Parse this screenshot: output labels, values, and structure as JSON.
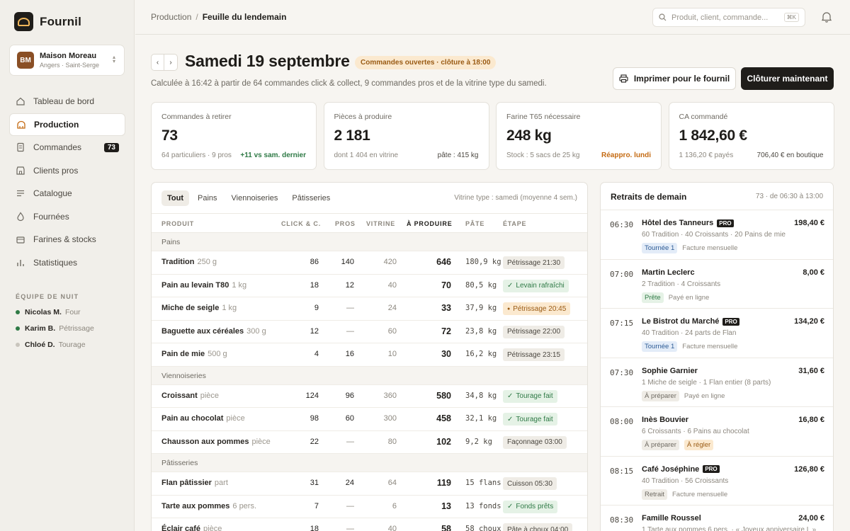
{
  "app": {
    "name": "Fournil"
  },
  "shop": {
    "initials": "BM",
    "name": "Maison Moreau",
    "location": "Angers · Saint-Serge"
  },
  "nav": [
    {
      "label": "Tableau de bord",
      "icon": "home-icon"
    },
    {
      "label": "Production",
      "icon": "bakery-icon",
      "active": true
    },
    {
      "label": "Commandes",
      "icon": "document-icon",
      "badge": "73"
    },
    {
      "label": "Clients pros",
      "icon": "storefront-icon"
    },
    {
      "label": "Catalogue",
      "icon": "list-icon"
    },
    {
      "label": "Fournées",
      "icon": "flame-icon"
    },
    {
      "label": "Farines & stocks",
      "icon": "stock-icon"
    },
    {
      "label": "Statistiques",
      "icon": "stats-icon"
    }
  ],
  "team": {
    "title": "ÉQUIPE DE NUIT",
    "members": [
      {
        "name": "Nicolas M.",
        "role": "Four",
        "color": "#2f7a46"
      },
      {
        "name": "Karim B.",
        "role": "Pétrissage",
        "color": "#2f7a46"
      },
      {
        "name": "Chloé D.",
        "role": "Tourage",
        "color": "#c9c5bd"
      }
    ]
  },
  "breadcrumb": {
    "parent": "Production",
    "current": "Feuille du lendemain"
  },
  "search": {
    "placeholder": "Produit, client, commande...",
    "shortcut": "⌘K"
  },
  "page": {
    "title": "Samedi 19 septembre",
    "status": "Commandes ouvertes · clôture à 18:00",
    "subtitle": "Calculée à 16:42 à partir de 64 commandes click & collect, 9 commandes pros et de la vitrine type du samedi.",
    "print_label": "Imprimer pour le fournil",
    "close_label": "Clôturer maintenant"
  },
  "kpis": [
    {
      "label": "Commandes à retirer",
      "value": "73",
      "foot_left": "64 particuliers · 9 pros",
      "foot_right": "+11 vs sam. dernier",
      "foot_style": "g"
    },
    {
      "label": "Pièces à produire",
      "value": "2 181",
      "foot_left": "dont 1 404 en vitrine",
      "foot_right": "pâte : 415 kg",
      "foot_style": "d"
    },
    {
      "label": "Farine T65 nécessaire",
      "value": "248 kg",
      "foot_left": "Stock : 5 sacs de 25 kg",
      "foot_right": "Réappro. lundi",
      "foot_style": "o"
    },
    {
      "label": "CA commandé",
      "value": "1 842,60 €",
      "foot_left": "1 136,20 € payés",
      "foot_right": "706,40 € en boutique",
      "foot_style": "d"
    }
  ],
  "table": {
    "tabs": [
      "Tout",
      "Pains",
      "Viennoiseries",
      "Pâtisseries"
    ],
    "note": "Vitrine type : samedi (moyenne 4 sem.)",
    "columns": [
      "PRODUIT",
      "CLICK & C.",
      "PROS",
      "VITRINE",
      "À PRODUIRE",
      "PÂTE",
      "ÉTAPE"
    ],
    "groups": [
      {
        "label": "Pains",
        "rows": [
          {
            "name": "Tradition",
            "unit": "250 g",
            "click": "86",
            "pros": "140",
            "vitrine": "420",
            "total": "646",
            "pate": "180,9 kg",
            "stage": "Pétrissage 21:30",
            "stage_style": "grey"
          },
          {
            "name": "Pain au levain T80",
            "unit": "1 kg",
            "click": "18",
            "pros": "12",
            "vitrine": "40",
            "total": "70",
            "pate": "80,5 kg",
            "stage": "Levain rafraîchi",
            "stage_style": "green"
          },
          {
            "name": "Miche de seigle",
            "unit": "1 kg",
            "click": "9",
            "pros": "—",
            "vitrine": "24",
            "total": "33",
            "pate": "37,9 kg",
            "stage": "Pétrissage 20:45",
            "stage_style": "orange"
          },
          {
            "name": "Baguette aux céréales",
            "unit": "300 g",
            "click": "12",
            "pros": "—",
            "vitrine": "60",
            "total": "72",
            "pate": "23,8 kg",
            "stage": "Pétrissage 22:00",
            "stage_style": "grey"
          },
          {
            "name": "Pain de mie",
            "unit": "500 g",
            "click": "4",
            "pros": "16",
            "vitrine": "10",
            "total": "30",
            "pate": "16,2 kg",
            "stage": "Pétrissage 23:15",
            "stage_style": "grey"
          }
        ]
      },
      {
        "label": "Viennoiseries",
        "rows": [
          {
            "name": "Croissant",
            "unit": "pièce",
            "click": "124",
            "pros": "96",
            "vitrine": "360",
            "total": "580",
            "pate": "34,8 kg",
            "stage": "Tourage fait",
            "stage_style": "green"
          },
          {
            "name": "Pain au chocolat",
            "unit": "pièce",
            "click": "98",
            "pros": "60",
            "vitrine": "300",
            "total": "458",
            "pate": "32,1 kg",
            "stage": "Tourage fait",
            "stage_style": "green"
          },
          {
            "name": "Chausson aux pommes",
            "unit": "pièce",
            "click": "22",
            "pros": "—",
            "vitrine": "80",
            "total": "102",
            "pate": "9,2 kg",
            "stage": "Façonnage 03:00",
            "stage_style": "grey"
          }
        ]
      },
      {
        "label": "Pâtisseries",
        "rows": [
          {
            "name": "Flan pâtissier",
            "unit": "part",
            "click": "31",
            "pros": "24",
            "vitrine": "64",
            "total": "119",
            "pate": "15 flans",
            "stage": "Cuisson 05:30",
            "stage_style": "grey"
          },
          {
            "name": "Tarte aux pommes",
            "unit": "6 pers.",
            "click": "7",
            "pros": "—",
            "vitrine": "6",
            "total": "13",
            "pate": "13 fonds",
            "stage": "Fonds prêts",
            "stage_style": "green"
          },
          {
            "name": "Éclair café",
            "unit": "pièce",
            "click": "18",
            "pros": "—",
            "vitrine": "40",
            "total": "58",
            "pate": "58 choux",
            "stage": "Pâte à choux 04:00",
            "stage_style": "grey"
          }
        ]
      }
    ]
  },
  "pickups": {
    "title": "Retraits de demain",
    "meta": "73 · de 06:30 à 13:00",
    "items": [
      {
        "time": "06:30",
        "name": "Hôtel des Tanneurs",
        "pro": "PRO",
        "amount": "198,40 €",
        "items": "60 Tradition · 40 Croissants · 20 Pains de mie",
        "tag": "Tournée 1",
        "tag_style": "blue",
        "note": "Facture mensuelle"
      },
      {
        "time": "07:00",
        "name": "Martin Leclerc",
        "pro": "",
        "amount": "8,00 €",
        "items": "2 Tradition · 4 Croissants",
        "tag": "Prête",
        "tag_style": "green",
        "note": "Payé en ligne"
      },
      {
        "time": "07:15",
        "name": "Le Bistrot du Marché",
        "pro": "PRO",
        "amount": "134,20 €",
        "items": "40 Tradition · 24 parts de Flan",
        "tag": "Tournée 1",
        "tag_style": "blue",
        "note": "Facture mensuelle"
      },
      {
        "time": "07:30",
        "name": "Sophie Garnier",
        "pro": "",
        "amount": "31,60 €",
        "items": "1 Miche de seigle · 1 Flan entier (8 parts)",
        "tag": "À préparer",
        "tag_style": "grey",
        "note": "Payé en ligne"
      },
      {
        "time": "08:00",
        "name": "Inès Bouvier",
        "pro": "",
        "amount": "16,80 €",
        "items": "6 Croissants · 6 Pains au chocolat",
        "tag": "À préparer",
        "tag_style": "grey",
        "tag2": "À régler",
        "tag2_style": "orange",
        "note": ""
      },
      {
        "time": "08:15",
        "name": "Café Joséphine",
        "pro": "PRO",
        "amount": "126,80 €",
        "items": "40 Tradition · 56 Croissants",
        "tag": "Retrait",
        "tag_style": "grey",
        "note": "Facture mensuelle"
      },
      {
        "time": "08:30",
        "name": "Famille Roussel",
        "pro": "",
        "amount": "24,00 €",
        "items": "1 Tarte aux pommes 6 pers. · « Joyeux anniversaire L »",
        "tag": "",
        "tag_style": "grey",
        "note": ""
      }
    ]
  },
  "colors": {
    "accent": "#1f1d1a",
    "brand": "#8a4f25",
    "green": "#2f7a46",
    "orange": "#c46a12"
  }
}
